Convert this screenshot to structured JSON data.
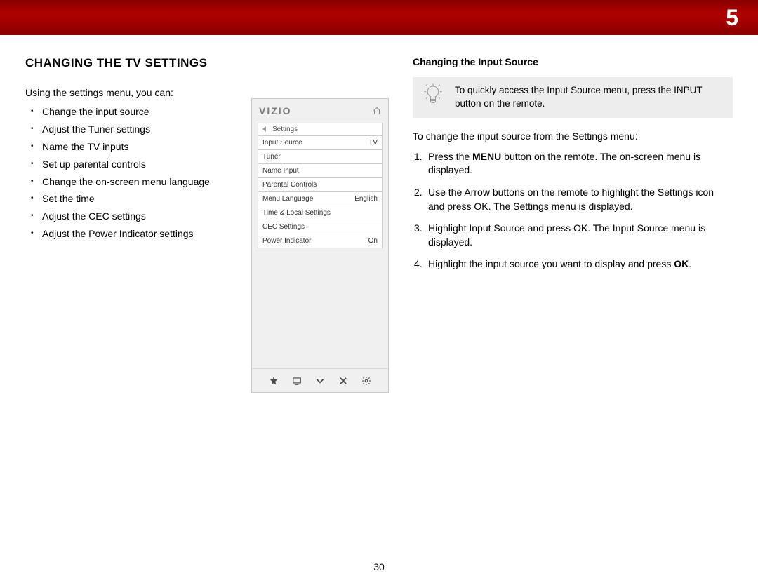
{
  "chapter_number": "5",
  "page_number": "30",
  "left": {
    "heading": "CHANGING THE TV SETTINGS",
    "intro": "Using the settings menu, you can:",
    "bullets": [
      "Change the input source",
      "Adjust the Tuner settings",
      "Name the TV inputs",
      "Set up parental controls",
      "Change the on-screen menu language",
      "Set the time",
      "Adjust the CEC settings",
      "Adjust the Power Indicator settings"
    ]
  },
  "tv_menu": {
    "logo": "VIZIO",
    "title": "Settings",
    "rows": [
      {
        "label": "Input Source",
        "value": "TV"
      },
      {
        "label": "Tuner",
        "value": ""
      },
      {
        "label": "Name Input",
        "value": ""
      },
      {
        "label": "Parental Controls",
        "value": ""
      },
      {
        "label": "Menu Language",
        "value": "English"
      },
      {
        "label": "Time & Local Settings",
        "value": ""
      },
      {
        "label": "CEC Settings",
        "value": ""
      },
      {
        "label": "Power Indicator",
        "value": "On"
      }
    ]
  },
  "right": {
    "heading": "Changing the Input Source",
    "tip": "To quickly access the Input Source menu, press the INPUT button on the remote.",
    "lead": "To change the input source from the Settings menu:",
    "steps_menu_word": "MENU",
    "steps_ok_word": "OK",
    "step1a": "Press the ",
    "step1b": " button on the remote. The on-screen menu is displayed.",
    "step2": "Use the Arrow buttons on the remote to highlight the Settings icon and press OK. The Settings menu is displayed.",
    "step3": "Highlight Input Source and press OK. The Input Source menu is displayed.",
    "step4a": "Highlight the input source you want to display and press ",
    "step4b": "."
  }
}
